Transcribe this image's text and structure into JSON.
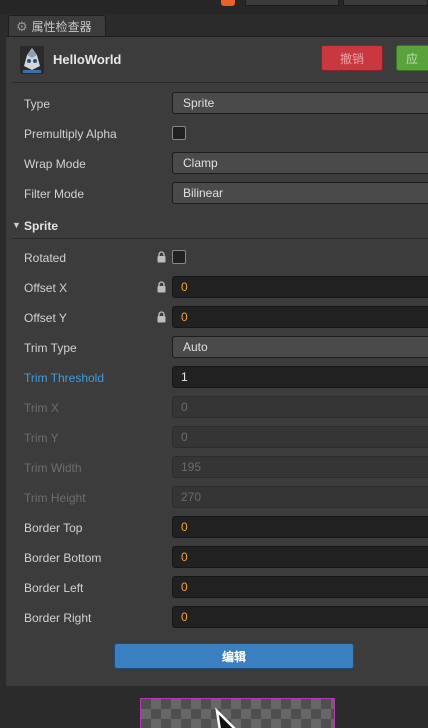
{
  "panel_tab": {
    "title": "属性检查器",
    "icon": "gear-icon"
  },
  "header": {
    "node_name": "HelloWorld",
    "revert_label": "撤销",
    "apply_label": "应"
  },
  "fields": {
    "type": {
      "label": "Type",
      "value": "Sprite"
    },
    "premultiply_alpha": {
      "label": "Premultiply Alpha",
      "checked": false
    },
    "wrap_mode": {
      "label": "Wrap Mode",
      "value": "Clamp"
    },
    "filter_mode": {
      "label": "Filter Mode",
      "value": "Bilinear"
    }
  },
  "sprite_section": {
    "title": "Sprite",
    "rotated": {
      "label": "Rotated",
      "checked": false
    },
    "offset_x": {
      "label": "Offset X",
      "value": "0"
    },
    "offset_y": {
      "label": "Offset Y",
      "value": "0"
    },
    "trim_type": {
      "label": "Trim Type",
      "value": "Auto"
    },
    "trim_threshold": {
      "label": "Trim Threshold",
      "value": "1"
    },
    "trim_x": {
      "label": "Trim X",
      "value": "0"
    },
    "trim_y": {
      "label": "Trim Y",
      "value": "0"
    },
    "trim_width": {
      "label": "Trim Width",
      "value": "195"
    },
    "trim_height": {
      "label": "Trim Height",
      "value": "270"
    },
    "border_top": {
      "label": "Border Top",
      "value": "0"
    },
    "border_bottom": {
      "label": "Border Bottom",
      "value": "0"
    },
    "border_left": {
      "label": "Border Left",
      "value": "0"
    },
    "border_right": {
      "label": "Border Right",
      "value": "0"
    }
  },
  "edit_button": {
    "label": "编辑"
  },
  "colors": {
    "accent_orange": "#f0a43c",
    "highlight_blue": "#3f9bdc",
    "revert_red": "#c8383e",
    "apply_green": "#5aa23c",
    "edit_blue": "#3a7fbf",
    "preview_border": "#b13bb1"
  }
}
